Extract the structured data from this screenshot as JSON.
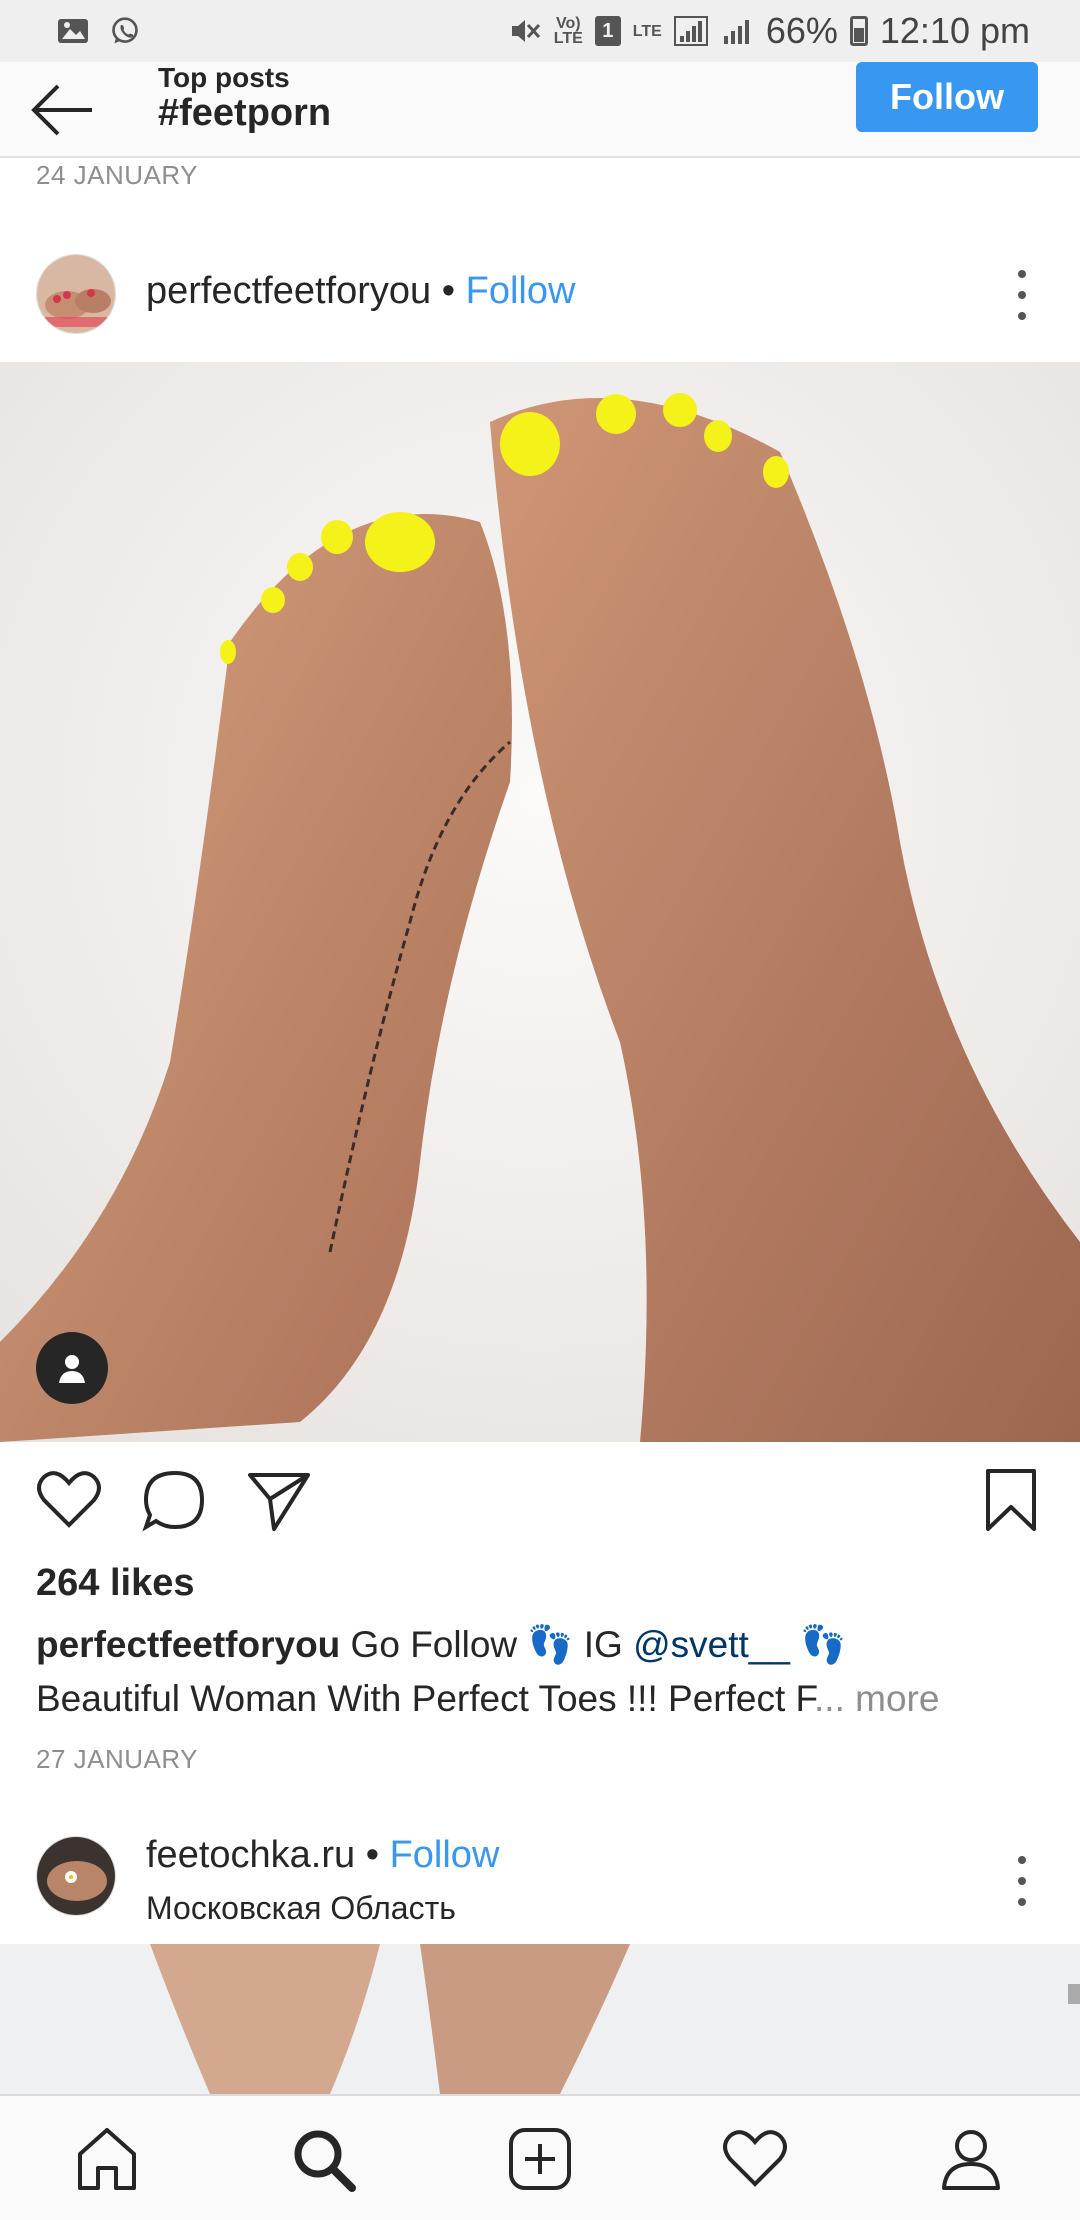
{
  "status_bar": {
    "battery": "66%",
    "time": "12:10 pm",
    "volte": "Vo)\nLTE",
    "sim": "1",
    "lte": "LTE"
  },
  "header": {
    "subtitle": "Top posts",
    "title": "#feetporn",
    "follow_label": "Follow"
  },
  "feed": {
    "date_top": "24 JANUARY",
    "post1": {
      "username": "perfectfeetforyou",
      "separator": "•",
      "follow_label": "Follow",
      "likes": "264 likes",
      "caption_user": "perfectfeetforyou",
      "caption_text_1": " Go Follow 👣 IG  ",
      "caption_mention": "@svett__",
      "caption_text_2": " 👣",
      "caption_line2": "Beautiful Woman With Perfect Toes !!! Perfect F",
      "caption_ellipsis": "... ",
      "caption_more": "more",
      "date": "27 JANUARY"
    },
    "post2": {
      "username": "feetochka.ru",
      "separator": "•",
      "follow_label": "Follow",
      "location": "Московская Область"
    }
  },
  "colors": {
    "accent": "#3897f0",
    "nail": "#f5f21a",
    "skin": "#c9936f",
    "fur": "#f1efee"
  },
  "icons": {
    "back": "arrow-left-icon",
    "more": "more-vertical-icon",
    "like": "heart-icon",
    "comment": "comment-icon",
    "share": "send-icon",
    "save": "bookmark-icon",
    "tag": "user-tag-icon",
    "nav": [
      "home-icon",
      "search-icon",
      "add-icon",
      "activity-heart-icon",
      "profile-icon"
    ]
  }
}
